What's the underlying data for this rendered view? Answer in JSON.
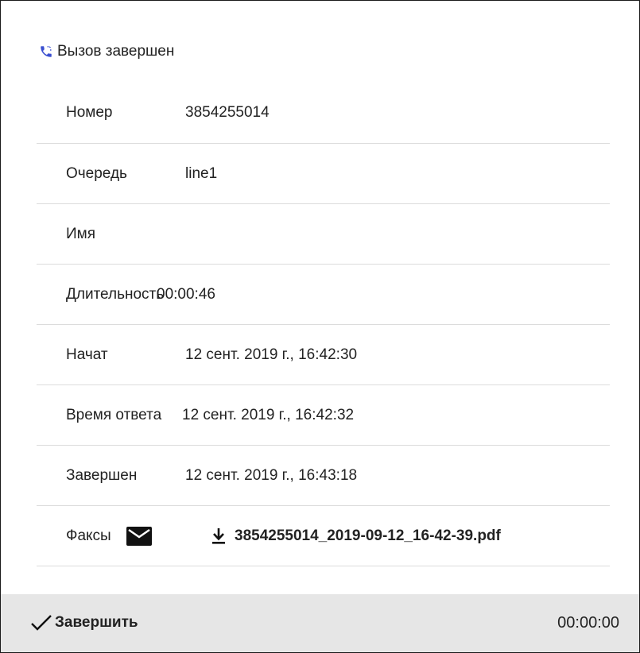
{
  "header": {
    "title": "Вызов завершен",
    "icon": "phone-call-ended-icon",
    "icon_color": "#3a4fd0"
  },
  "details": [
    {
      "label": "Номер",
      "value": "3854255014"
    },
    {
      "label": "Очередь",
      "value": "line1"
    },
    {
      "label": "Имя",
      "value": ""
    },
    {
      "label": "Длительность",
      "value": "00:00:46"
    },
    {
      "label": "Начат",
      "value": "12 сент. 2019 г., 16:42:30"
    },
    {
      "label": "Время ответа",
      "value": "12 сент. 2019 г., 16:42:32"
    },
    {
      "label": "Завершен",
      "value": "12 сент. 2019 г., 16:43:18"
    }
  ],
  "fax": {
    "label": "Факсы",
    "icon": "mail-icon",
    "file_icon": "download-icon",
    "file_name": "3854255014_2019-09-12_16-42-39.pdf"
  },
  "footer": {
    "finish_label": "Завершить",
    "finish_icon": "check-icon",
    "timer": "00:00:00",
    "background": "#e6e6e6"
  }
}
